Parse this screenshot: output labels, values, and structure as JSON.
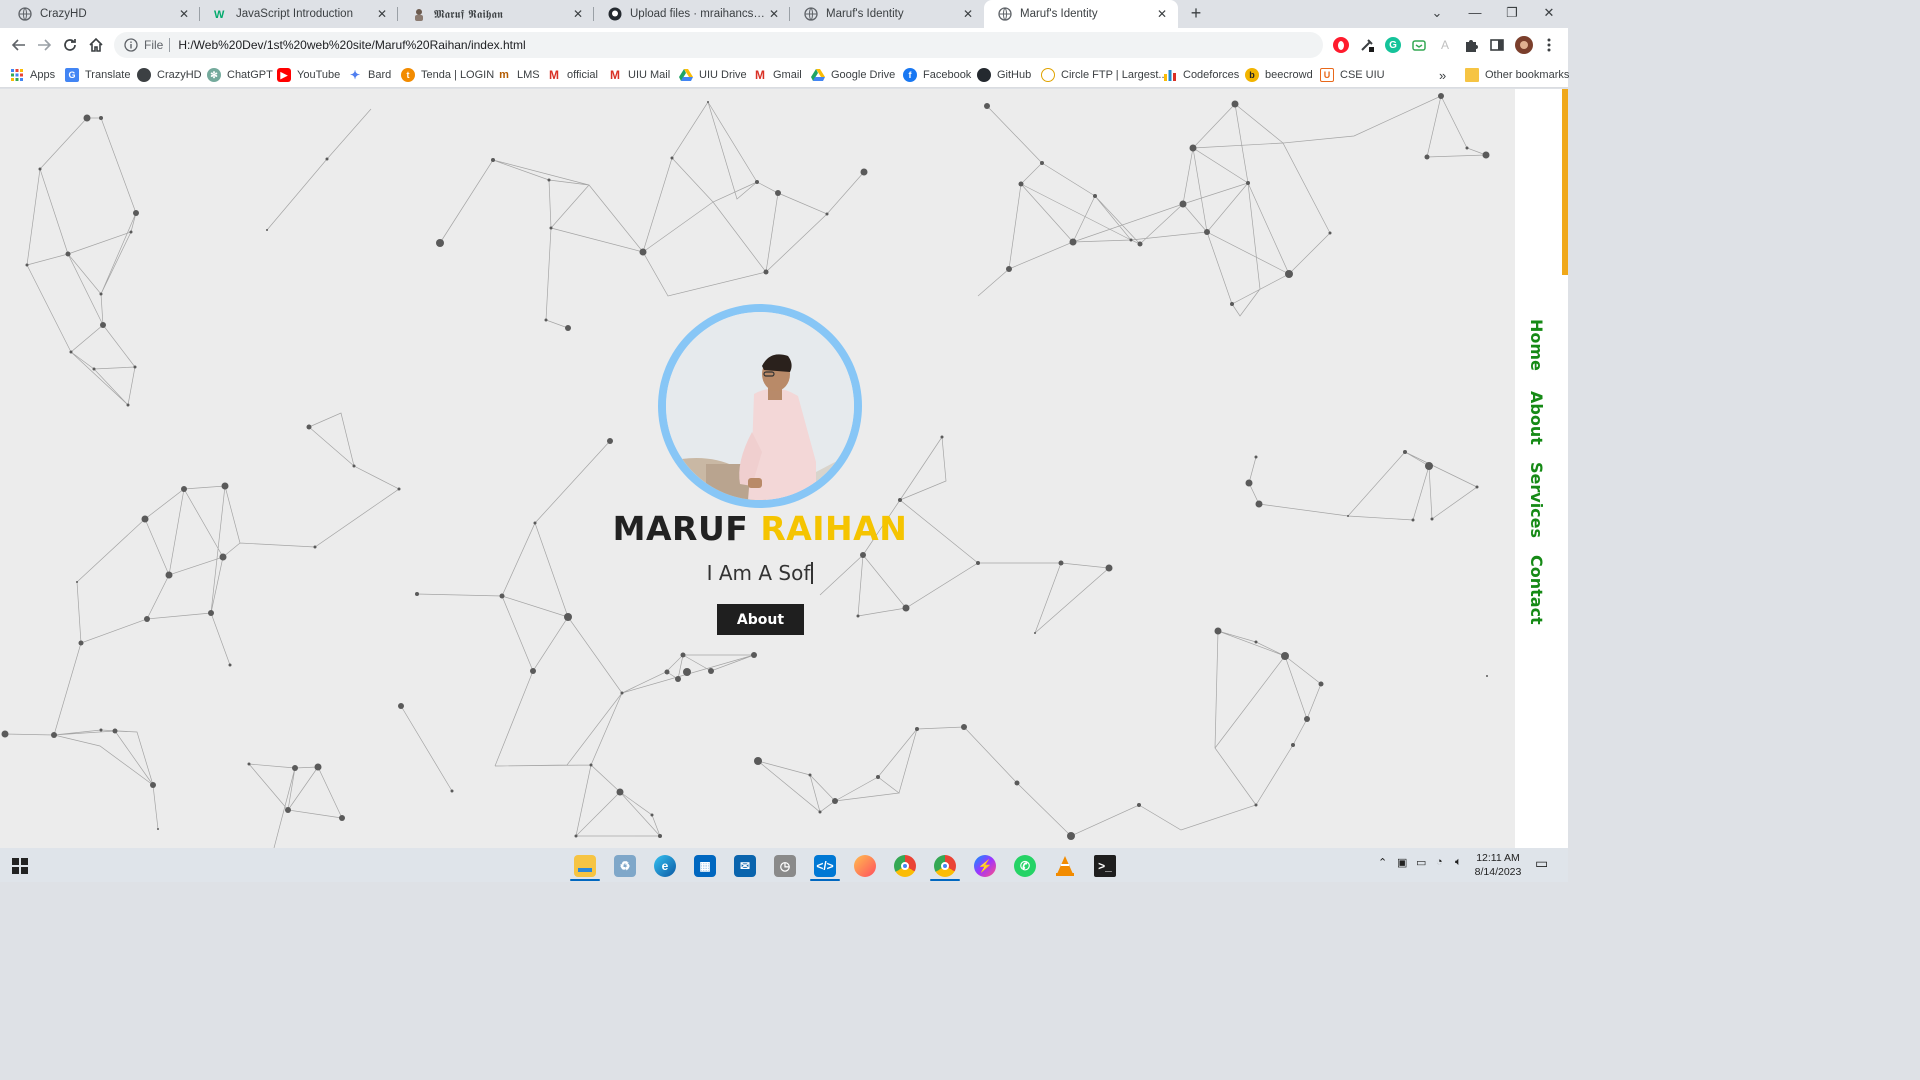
{
  "browser": {
    "tabs": [
      {
        "title": "CrazyHD",
        "icon": "globe-icon",
        "active": false
      },
      {
        "title": "JavaScript Introduction",
        "icon": "w3schools-icon",
        "active": false
      },
      {
        "title": "𝕸𝖆𝖗𝖚𝖋 𝕽𝖆𝖎𝖍𝖆𝖓",
        "icon": "avatar-icon",
        "active": false
      },
      {
        "title": "Upload files · mraihancs/portfolic",
        "icon": "github-icon",
        "active": false
      },
      {
        "title": "Maruf's Identity",
        "icon": "globe-icon",
        "active": false
      },
      {
        "title": "Maruf's Identity",
        "icon": "globe-icon",
        "active": true
      }
    ],
    "close_glyph": "✕",
    "new_tab_glyph": "+",
    "window_controls": {
      "dropdown": "⌄",
      "minimize": "—",
      "restore": "❐",
      "close": "✕"
    },
    "address": {
      "scheme_label": "File",
      "url": "H:/Web%20Dev/1st%20web%20site/Maruf%20Raihan/index.html"
    },
    "bookmarks": [
      {
        "label": "Apps",
        "icon": "apps-grid-icon",
        "color": "#4285f4"
      },
      {
        "label": "Translate",
        "icon": "translate-icon",
        "color": "#4285f4"
      },
      {
        "label": "CrazyHD",
        "icon": "globe-icon",
        "color": "#5f6368"
      },
      {
        "label": "ChatGPT",
        "icon": "chatgpt-icon",
        "color": "#74aa9c"
      },
      {
        "label": "YouTube",
        "icon": "youtube-icon",
        "color": "#ff0000"
      },
      {
        "label": "Bard",
        "icon": "bard-icon",
        "color": "#4f7ef0"
      },
      {
        "label": "Tenda | LOGIN",
        "icon": "tenda-icon",
        "color": "#f28b00"
      },
      {
        "label": "LMS",
        "icon": "lms-icon",
        "color": "#b35b00"
      },
      {
        "label": "official",
        "icon": "gmail-icon",
        "color": "#d93025"
      },
      {
        "label": "UIU Mail",
        "icon": "gmail-icon",
        "color": "#d93025"
      },
      {
        "label": "UIU Drive",
        "icon": "drive-icon",
        "color": "#1fa463"
      },
      {
        "label": "Gmail",
        "icon": "gmail-icon",
        "color": "#d93025"
      },
      {
        "label": "Google Drive",
        "icon": "drive-icon",
        "color": "#1fa463"
      },
      {
        "label": "Facebook",
        "icon": "facebook-icon",
        "color": "#1877f2"
      },
      {
        "label": "GitHub",
        "icon": "github-icon",
        "color": "#24292f"
      },
      {
        "label": "Circle FTP | Largest...",
        "icon": "ftp-icon",
        "color": "#e0a300"
      },
      {
        "label": "Codeforces",
        "icon": "codeforces-icon",
        "color": "#1f8acb"
      },
      {
        "label": "beecrowd",
        "icon": "beecrowd-icon",
        "color": "#f2b400"
      },
      {
        "label": "CSE UIU",
        "icon": "cse-uiu-icon",
        "color": "#e8681a"
      }
    ],
    "bookmarks_overflow": "»",
    "other_bookmarks": "Other bookmarks"
  },
  "hero": {
    "first_name": "MARUF",
    "last_name": "RAIHAN",
    "typed_text": "I Am A Sof",
    "about_button": "About",
    "ring_color": "#87c6f6",
    "highlight_color": "#f5c400"
  },
  "sidenav": {
    "items": [
      "Home",
      "About",
      "Services",
      "Contact"
    ],
    "color": "#168a16"
  },
  "taskbar": {
    "time": "12:11 AM",
    "date": "8/14/2023",
    "apps": [
      "file-explorer-icon",
      "recycle-icon",
      "edge-icon",
      "store-icon",
      "mail-icon",
      "clock-icon",
      "vscode-icon",
      "firefox-icon",
      "chrome-icon",
      "chrome-profile-icon",
      "messenger-icon",
      "whatsapp-icon",
      "vlc-icon",
      "terminal-icon"
    ]
  }
}
